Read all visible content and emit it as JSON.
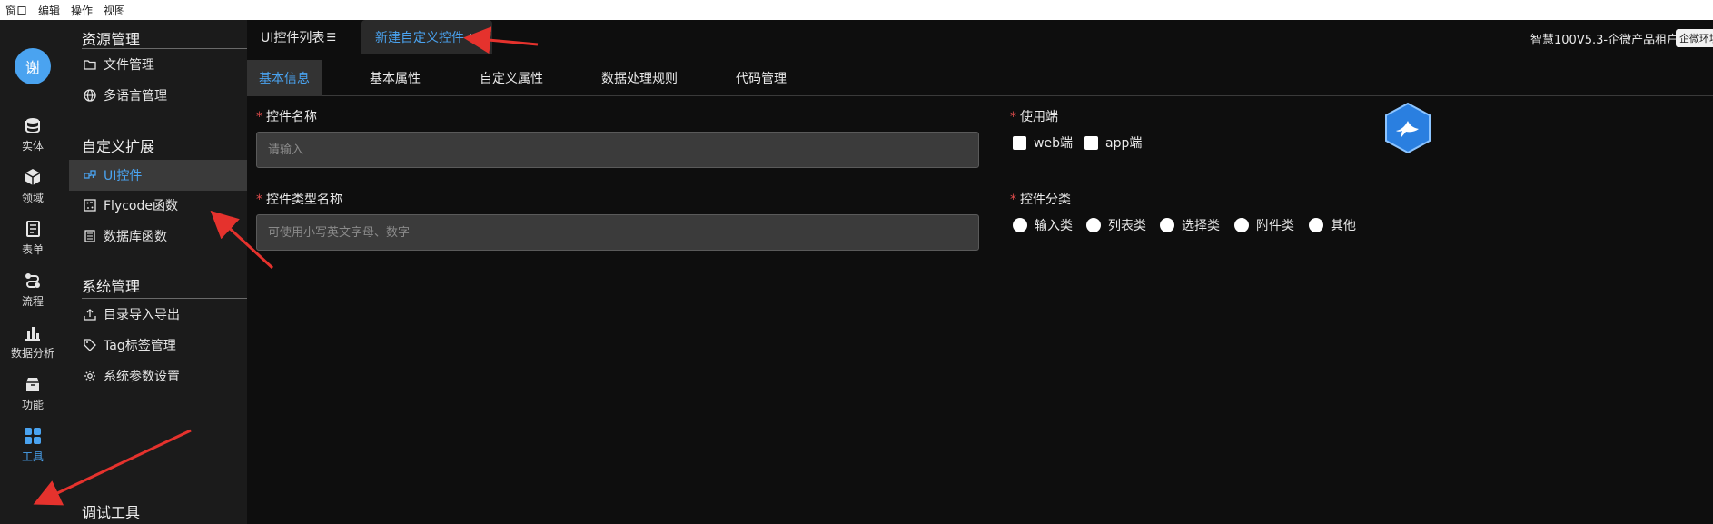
{
  "menubar": {
    "items": [
      "窗口",
      "编辑",
      "操作",
      "视图"
    ]
  },
  "rail": {
    "avatar_text": "谢",
    "items": [
      {
        "label": "实体",
        "icon": "database-icon"
      },
      {
        "label": "领域",
        "icon": "cube-icon"
      },
      {
        "label": "表单",
        "icon": "form-icon"
      },
      {
        "label": "流程",
        "icon": "flow-icon"
      },
      {
        "label": "数据分析",
        "icon": "bar-chart-icon"
      },
      {
        "label": "功能",
        "icon": "box-icon"
      },
      {
        "label": "工具",
        "icon": "grid-icon",
        "active": true
      }
    ]
  },
  "sidebar": {
    "sections": [
      {
        "title": "资源管理",
        "items": [
          {
            "label": "文件管理",
            "icon": "folder-icon"
          },
          {
            "label": "多语言管理",
            "icon": "globe-icon"
          }
        ]
      },
      {
        "title": "自定义扩展",
        "items": [
          {
            "label": "UI控件",
            "icon": "ui-control-icon",
            "active": true
          },
          {
            "label": "Flycode函数",
            "icon": "code-icon"
          },
          {
            "label": "数据库函数",
            "icon": "db-function-icon"
          }
        ]
      },
      {
        "title": "系统管理",
        "items": [
          {
            "label": "目录导入导出",
            "icon": "upload-icon"
          },
          {
            "label": "Tag标签管理",
            "icon": "tag-icon"
          },
          {
            "label": "系统参数设置",
            "icon": "settings-icon"
          }
        ]
      },
      {
        "title": "调试工具",
        "items": []
      }
    ]
  },
  "tabs": [
    {
      "label": "UI控件列表",
      "close": "☰",
      "active": false
    },
    {
      "label": "新建自定义控件",
      "close": "×",
      "active": true
    }
  ],
  "tenant": "智慧100V5.3-企微产品租户",
  "env_badge": "企微环境",
  "subtabs": [
    "基本信息",
    "基本属性",
    "自定义属性",
    "数据处理规则",
    "代码管理"
  ],
  "form": {
    "name_label": "控件名称",
    "name_placeholder": "请输入",
    "type_label": "控件类型名称",
    "type_placeholder": "可使用小写英文字母、数字",
    "terminal_label": "使用端",
    "terminal_options": [
      "web端",
      "app端"
    ],
    "category_label": "控件分类",
    "category_options": [
      "输入类",
      "列表类",
      "选择类",
      "附件类",
      "其他"
    ]
  },
  "colors": {
    "accent": "#4aa3f0",
    "required": "#e34d4d",
    "arrow": "#e5322d"
  }
}
